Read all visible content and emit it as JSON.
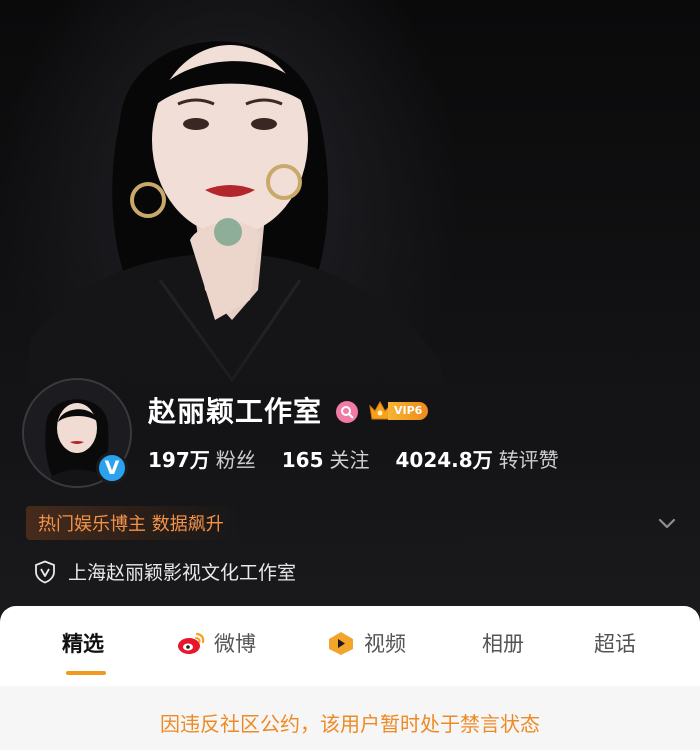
{
  "profile": {
    "name": "赵丽颖工作室",
    "vip_level": "VIP6",
    "verified_mark": "V",
    "stats": [
      {
        "value": "197万",
        "label": "粉丝"
      },
      {
        "value": "165",
        "label": "关注"
      },
      {
        "value": "4024.8万",
        "label": "转评赞"
      }
    ],
    "hot_tag": "热门娱乐博主 数据飙升",
    "company": "上海赵丽颖影视文化工作室"
  },
  "tabs": [
    {
      "label": "精选",
      "icon": "",
      "active": true
    },
    {
      "label": "微博",
      "icon": "weibo-icon",
      "active": false
    },
    {
      "label": "视频",
      "icon": "video-play-icon",
      "active": false
    },
    {
      "label": "相册",
      "icon": "",
      "active": false
    },
    {
      "label": "超话",
      "icon": "",
      "active": false
    }
  ],
  "notice": "因违反社区公约，该用户暂时处于禁言状态",
  "colors": {
    "accent_orange": "#f39a1e",
    "notice_text": "#ee8a26",
    "verified_blue": "#2aa2f0",
    "hot_tag_text": "#f3934a",
    "vip_gold": "#f7b431"
  }
}
